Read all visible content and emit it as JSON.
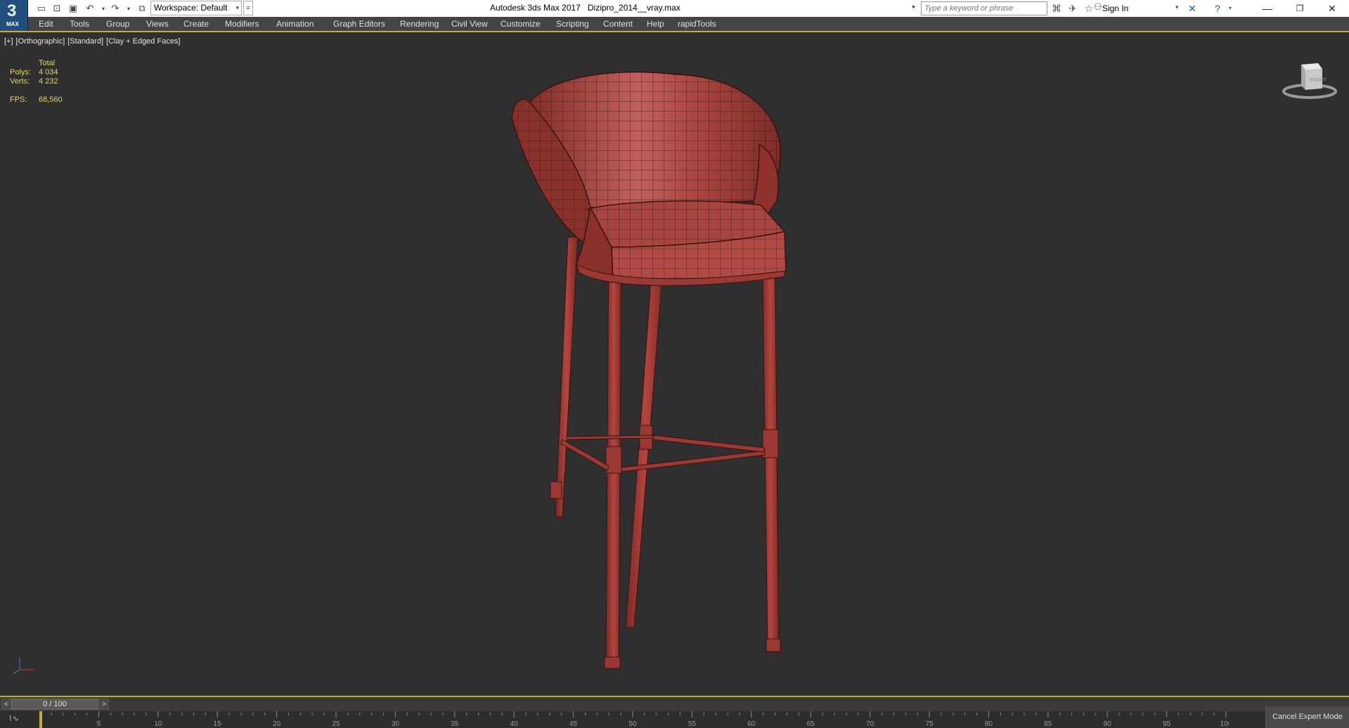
{
  "app": {
    "logo_text": "3",
    "logo_sub": "MAX",
    "title": "Autodesk 3ds Max 2017",
    "file_name": "Dizipro_2014__vray.max"
  },
  "quick_access": {
    "workspace_label": "Workspace: Default"
  },
  "search": {
    "placeholder": "Type a keyword or phrase"
  },
  "account": {
    "sign_in_label": "Sign In"
  },
  "menu": {
    "items": [
      "Edit",
      "Tools",
      "Group",
      "Views",
      "Create",
      "Modifiers",
      "Animation",
      "Graph Editors",
      "Rendering",
      "Civil View",
      "Customize",
      "Scripting",
      "Content",
      "Help",
      "rapidTools"
    ]
  },
  "viewport": {
    "label_plus": "[+]",
    "label_view": "[Orthographic]",
    "label_shading_std": "[Standard]",
    "label_shading": "[Clay + Edged Faces]",
    "stats": {
      "total_label": "Total",
      "polys_label": "Polys:",
      "polys_value": "4 034",
      "verts_label": "Verts:",
      "verts_value": "4 232",
      "fps_label": "FPS:",
      "fps_value": "68,560"
    }
  },
  "timeline": {
    "slider_label": "0 / 100",
    "prev_label": "<",
    "next_label": ">",
    "current_frame": 0,
    "total_frames": 100,
    "ruler_labels": [
      "0",
      "5",
      "10",
      "15",
      "20",
      "25",
      "30",
      "35",
      "40",
      "45",
      "50",
      "55",
      "60",
      "65",
      "70",
      "75",
      "80",
      "85",
      "90",
      "95",
      "100"
    ]
  },
  "status": {
    "cancel_expert_label": "Cancel Expert Mode"
  },
  "colors": {
    "model": "#b2433d",
    "accent": "#c8a93a",
    "stats_text": "#e7d36a"
  }
}
